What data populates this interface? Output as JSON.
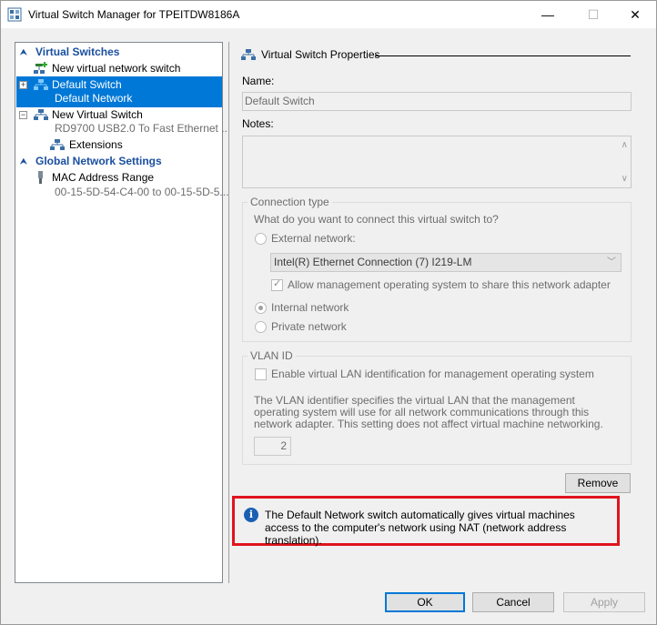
{
  "window": {
    "title": "Virtual Switch Manager for TPEITDW8186A"
  },
  "titlebar": {
    "minimize": "—",
    "maximize": "☐",
    "close": "✕"
  },
  "tree": {
    "virtual_switches_header": "Virtual Switches",
    "new_switch": "New virtual network switch",
    "default_switch": {
      "name": "Default Switch",
      "sub": "Default Network"
    },
    "new_virtual_switch": {
      "name": "New Virtual Switch",
      "sub": "RD9700 USB2.0 To Fast Ethernet ...",
      "extensions": "Extensions"
    },
    "global_header": "Global Network Settings",
    "mac_range": {
      "name": "MAC Address Range",
      "sub": "00-15-5D-54-C4-00 to 00-15-5D-5..."
    }
  },
  "props": {
    "group_title": "Virtual Switch Properties",
    "name_label": "Name:",
    "name_value": "Default Switch",
    "notes_label": "Notes:",
    "connection_type": {
      "legend": "Connection type",
      "question": "What do you want to connect this virtual switch to?",
      "external": "External network:",
      "adapter": "Intel(R) Ethernet Connection (7) I219-LM",
      "allow_mgmt": "Allow management operating system to share this network adapter",
      "internal": "Internal network",
      "private": "Private network"
    },
    "vlan": {
      "legend": "VLAN ID",
      "enable": "Enable virtual LAN identification for management operating system",
      "desc": "The VLAN identifier specifies the virtual LAN that the management operating system will use for all network communications through this network adapter. This setting does not affect virtual machine networking.",
      "value": "2"
    },
    "remove": "Remove",
    "info": "The Default Network switch automatically gives virtual machines access to the computer's network using NAT (network address translation)."
  },
  "footer": {
    "ok": "OK",
    "cancel": "Cancel",
    "apply": "Apply"
  },
  "colors": {
    "selection": "#0078d7",
    "header_blue": "#1a4fa0",
    "highlight_border": "#e0141e"
  }
}
